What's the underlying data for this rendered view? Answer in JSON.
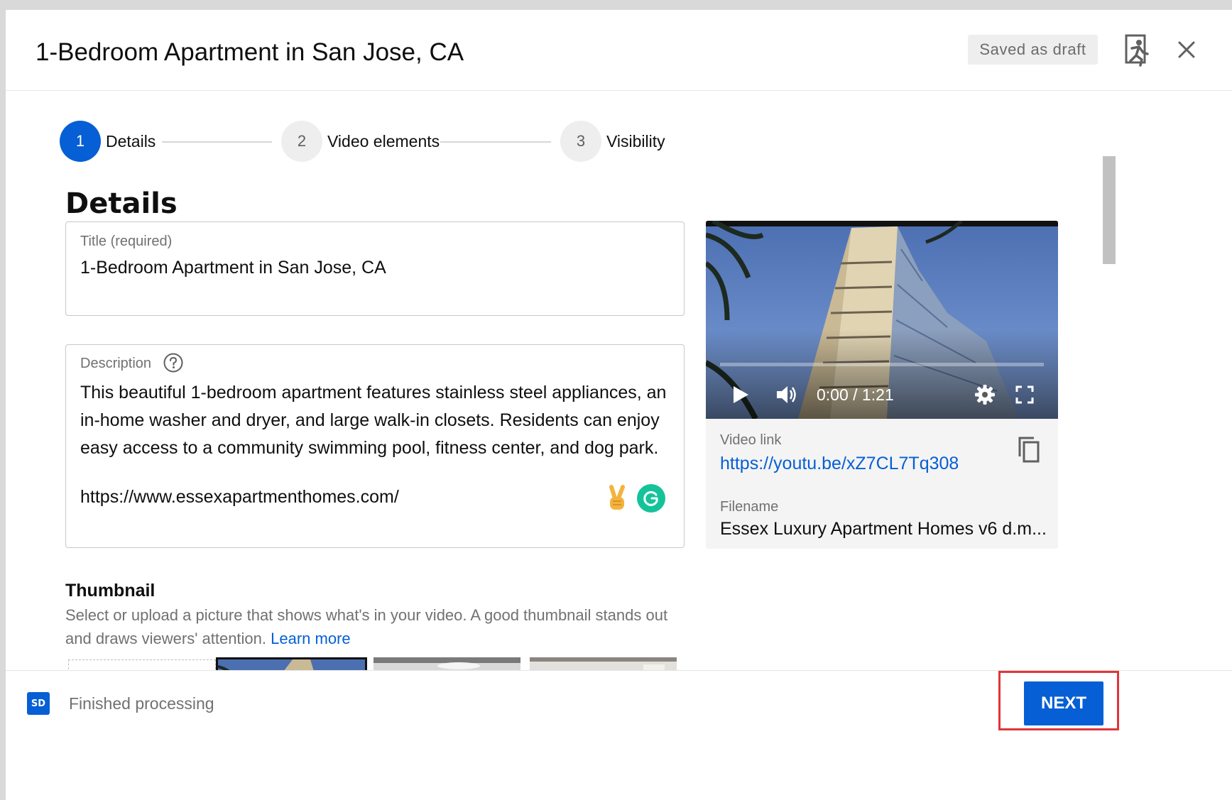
{
  "header": {
    "title": "1-Bedroom Apartment in San Jose, CA",
    "draft_status": "Saved as draft",
    "icons": [
      "feedback-icon",
      "close-icon"
    ]
  },
  "stepper": {
    "steps": [
      {
        "number": "1",
        "label": "Details",
        "state": "active"
      },
      {
        "number": "2",
        "label": "Video elements",
        "state": "inactive"
      },
      {
        "number": "3",
        "label": "Visibility",
        "state": "inactive"
      }
    ]
  },
  "details": {
    "heading": "Details",
    "title_field": {
      "label": "Title (required)",
      "value": "1-Bedroom Apartment in San Jose, CA"
    },
    "description_field": {
      "label": "Description",
      "text": "This beautiful 1-bedroom apartment features stainless steel appliances, an in-home washer and dryer, and large walk-in closets. Residents can enjoy easy access to a community swimming pool, fitness center, and dog park.",
      "url": "https://www.essexapartmenthomes.com/"
    }
  },
  "video": {
    "time": "0:00 / 1:21",
    "progress": 0,
    "link_label": "Video link",
    "link": "https://youtu.be/xZ7CL7Tq308",
    "filename_label": "Filename",
    "filename": "Essex Luxury Apartment Homes v6 d.m..."
  },
  "thumbnail": {
    "heading": "Thumbnail",
    "description": "Select or upload a picture that shows what's in your video. A good thumbnail stands out and draws viewers' attention.",
    "learn_more": "Learn more"
  },
  "footer": {
    "badge": "SD",
    "status": "Finished processing",
    "next_label": "NEXT"
  },
  "colors": {
    "accent": "#065fd4",
    "highlight": "#e0353a",
    "grammarly": "#15c39a"
  }
}
